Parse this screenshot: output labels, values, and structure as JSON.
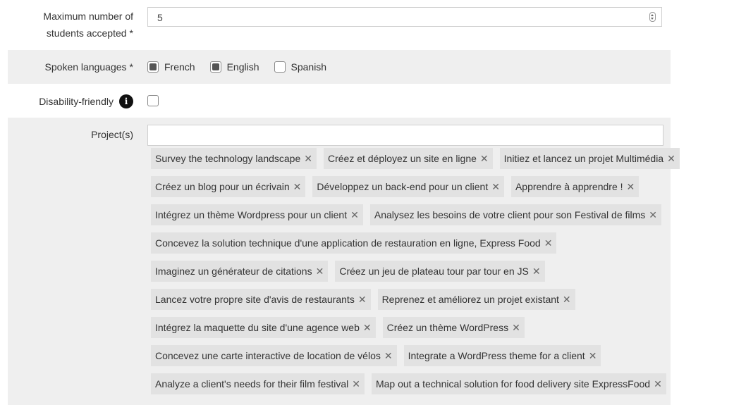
{
  "max_students": {
    "label_line1": "Maximum number of",
    "label_line2": "students accepted",
    "required_mark": "*",
    "value": "5"
  },
  "spoken_languages": {
    "label": "Spoken languages",
    "required_mark": "*",
    "options": [
      {
        "label": "French",
        "checked": true
      },
      {
        "label": "English",
        "checked": true
      },
      {
        "label": "Spanish",
        "checked": false
      }
    ]
  },
  "disability": {
    "label": "Disability-friendly",
    "info_glyph": "i",
    "checked": false
  },
  "projects": {
    "label": "Project(s)",
    "input_value": "",
    "remove_glyph": "✕",
    "tags": [
      "Survey the technology landscape",
      "Créez et déployez un site en ligne",
      "Initiez et lancez un projet Multimédia",
      "Créez un blog pour un écrivain",
      "Développez un back-end pour un client",
      "Apprendre à apprendre !",
      "Intégrez un thème Wordpress pour un client",
      "Analysez les besoins de votre client pour son Festival de films",
      "Concevez la solution technique d'une application de restauration en ligne, Express Food",
      "Imaginez un générateur de citations",
      "Créez un jeu de plateau tour par tour en JS",
      "Lancez votre propre site d'avis de restaurants",
      "Reprenez et améliorez un projet existant",
      "Intégrez la maquette du site d'une agence web",
      "Créez un thème WordPress",
      "Concevez une carte interactive de location de vélos",
      "Integrate a WordPress theme for a client",
      "Analyze a client's needs for their film festival",
      "Map out a technical solution for food delivery site ExpressFood"
    ]
  }
}
